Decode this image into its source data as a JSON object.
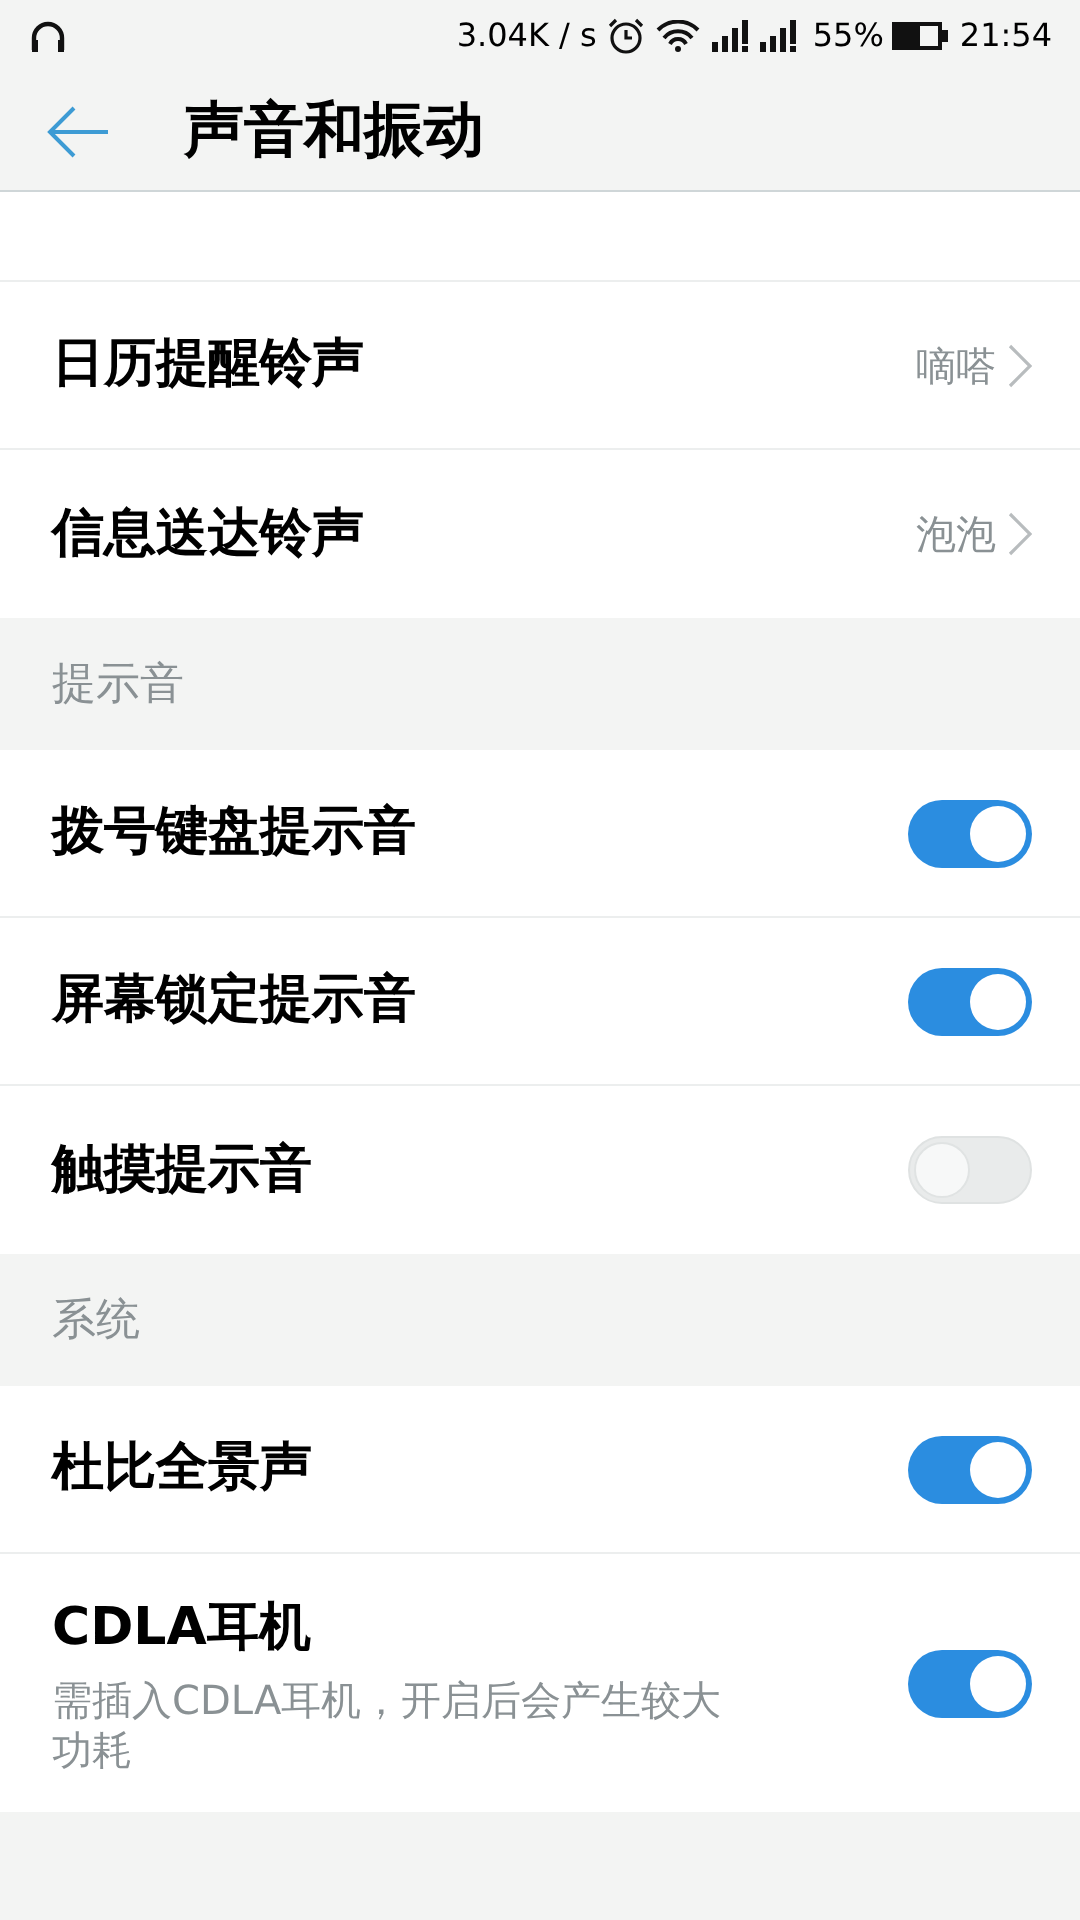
{
  "status_bar": {
    "net_speed": "3.04K / s",
    "battery": "55%",
    "time": "21:54"
  },
  "header": {
    "title": "声音和振动"
  },
  "sections": [
    {
      "items": [
        {
          "kind": "link",
          "label": "日历提醒铃声",
          "value": "嘀嗒"
        },
        {
          "kind": "link",
          "label": "信息送达铃声",
          "value": "泡泡"
        }
      ]
    },
    {
      "title": "提示音",
      "items": [
        {
          "kind": "toggle",
          "label": "拨号键盘提示音",
          "on": true
        },
        {
          "kind": "toggle",
          "label": "屏幕锁定提示音",
          "on": true
        },
        {
          "kind": "toggle",
          "label": "触摸提示音",
          "on": false
        }
      ]
    },
    {
      "title": "系统",
      "items": [
        {
          "kind": "toggle",
          "label": "杜比全景声",
          "on": true
        },
        {
          "kind": "toggle",
          "label": "CDLA耳机",
          "description": "需插入CDLA耳机，开启后会产生较大功耗",
          "on": true
        }
      ]
    }
  ]
}
